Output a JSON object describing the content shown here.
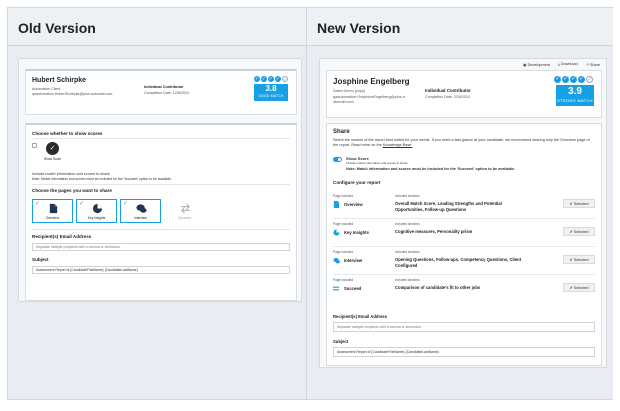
{
  "columns": {
    "old_title": "Old Version",
    "new_title": "New Version"
  },
  "old": {
    "name": "Hubert Schirpke",
    "role": "Automation Client",
    "email": "qaautomation.HubertSchirpke@plus.automatl.com",
    "contributor": "Individual Contributor",
    "completion": "Completion Date: 12/8/2024",
    "score": "3.8",
    "score_label": "GOOD MATCH",
    "show_scores_heading": "Choose whether to show scores",
    "show_scores_label": "Show Score",
    "note_line1": "Include match information and scores to share",
    "note_line2": "Note: Match information and scores must be included for the 'Succeed' option to be available.",
    "pages_heading": "Choose the pages you want to share",
    "tiles": [
      {
        "label": "Overview",
        "selected": true
      },
      {
        "label": "Key Insights",
        "selected": true
      },
      {
        "label": "Interview",
        "selected": true
      },
      {
        "label": "Succeed",
        "selected": false
      }
    ],
    "recipients_label": "Recipient(s) Email Address",
    "recipients_placeholder": "Separate multiple recipients with a comma or semicolon.",
    "subject_label": "Subject",
    "subject_value": "Assessment Report of {CandidateFirstName} {CandidateLastName}"
  },
  "new": {
    "top_actions": [
      "Development",
      "Download",
      "Share"
    ],
    "name": "Josphine Engelberg",
    "role": "Sales Demo (copy)",
    "email_line1": "qaautomation+JosphineEngelberg@plus.a",
    "email_line2": "utomatl.com",
    "contributor": "Individual Contributor",
    "completion": "Completion Date: 2/28/2024",
    "score": "3.9",
    "score_label": "STRONG MATCH",
    "share_heading": "Share",
    "share_desc": "Select the version of the report best suited for your needs. If you need a fast glance at your candidate, we recommend sharing only the Overview page of the report. Read more on the",
    "kb_link": "Knowledge Base.",
    "show_score_label": "Show Score",
    "show_score_sub": "Include match information and scores to share",
    "note": "Note: Match information and scores must be included for the 'Succeed' option to be available.",
    "configure_heading": "Configure your report",
    "col_page": "Page included",
    "col_sections": "Included sections",
    "rows": [
      {
        "page": "Overview",
        "sections": "Overall Match Score, Leading Strengths and Potential Opportunities, Follow-up Questions",
        "status": "Selected"
      },
      {
        "page": "Key Insights",
        "sections": "Cognitive measures, Personality prism",
        "status": "Selected"
      },
      {
        "page": "Interview",
        "sections": "Opening Questions, Follow-ups, Competency Questions, Client Configured",
        "status": "Selected"
      },
      {
        "page": "Succeed",
        "sections": "Comparison of candidate's fit to other jobs",
        "status": "Selected"
      }
    ],
    "recipients_label": "Recipient(s) Email Address",
    "recipients_placeholder": "Separate multiple recipients with a comma or semicolon.",
    "subject_label": "Subject",
    "subject_value": "Assessment Report of {CandidateFirstName} {CandidateLastName}"
  },
  "colors": {
    "accent": "#17a0e3",
    "header_bg": "#eef1f4",
    "panel_bg": "#e9edf1"
  }
}
